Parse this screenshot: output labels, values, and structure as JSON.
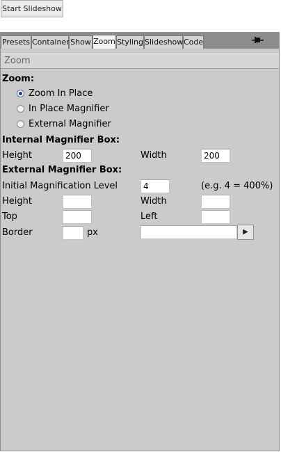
{
  "start_button": {
    "label": "Start Slideshow"
  },
  "tabs": [
    "Presets",
    "Container",
    "Show",
    "Zoom",
    "Styling",
    "Slideshow",
    "Code"
  ],
  "active_tab": "Zoom",
  "section": {
    "title": "Zoom"
  },
  "zoom": {
    "heading": "Zoom:",
    "options": [
      "Zoom In Place",
      "In Place Magnifier",
      "External Magnifier"
    ],
    "selected": "Zoom In Place"
  },
  "internal_box": {
    "heading": "Internal Magnifier Box:",
    "height_label": "Height",
    "height_value": "200",
    "width_label": "Width",
    "width_value": "200"
  },
  "external_box": {
    "heading": "External Magnifier Box:",
    "magnification_label": "Initial Magnification Level",
    "magnification_value": "4",
    "magnification_hint": "(e.g. 4 = 400%)",
    "height_label": "Height",
    "height_value": "",
    "width_label": "Width",
    "width_value": "",
    "top_label": "Top",
    "top_value": "",
    "left_label": "Left",
    "left_value": "",
    "border_label": "Border",
    "border_value": "",
    "border_unit": "px",
    "border_style_value": ""
  },
  "icons": {
    "pin": "pin-icon",
    "play": "play-icon"
  }
}
